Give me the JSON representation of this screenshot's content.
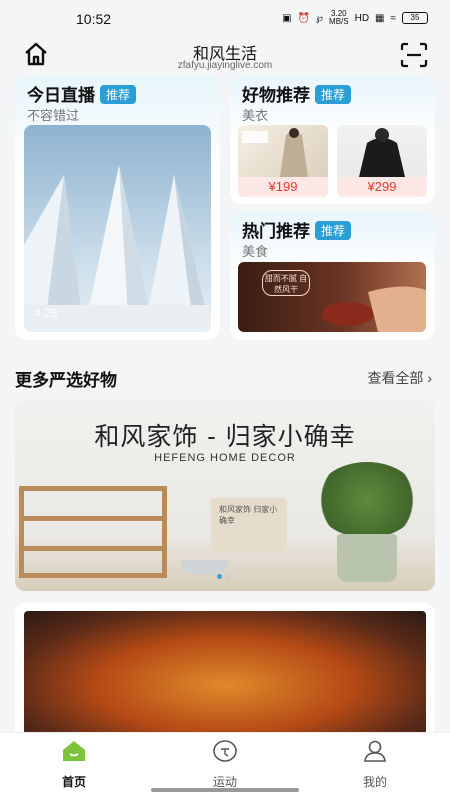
{
  "status": {
    "time": "10:52",
    "speed": "3.20",
    "speed_unit": "MB/S",
    "battery": "35"
  },
  "header": {
    "title": "和风生活",
    "url": "zfafyu.jiayinglive.com"
  },
  "live_card": {
    "title": "今日直播",
    "tag": "推荐",
    "subtitle": "不容错过",
    "image_label": "4.29"
  },
  "goods_card": {
    "title": "好物推荐",
    "tag": "推荐",
    "subtitle": "美衣",
    "products": [
      {
        "price": "¥199"
      },
      {
        "price": "¥299"
      }
    ]
  },
  "hot_card": {
    "title": "热门推荐",
    "tag": "推荐",
    "subtitle": "美食",
    "stamp": "甜而不腻 自然风干"
  },
  "section": {
    "title": "更多严选好物",
    "see_all": "查看全部"
  },
  "banner": {
    "title": "和风家饰 - 归家小确幸",
    "subtitle": "HEFENG HOME DECOR",
    "bag_text": "和风家饰 归家小确幸"
  },
  "tabbar": {
    "items": [
      {
        "label": "首页"
      },
      {
        "label": "运动"
      },
      {
        "label": "我的"
      }
    ],
    "active_color": "#7cc43a",
    "accent": "#2a9fd6"
  }
}
